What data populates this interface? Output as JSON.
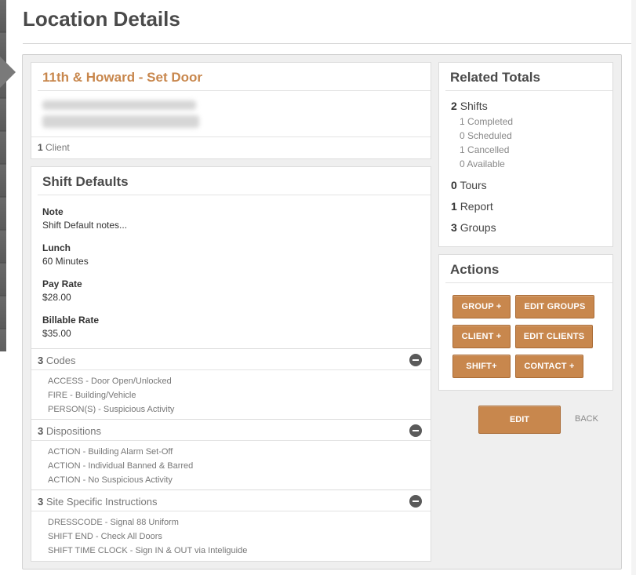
{
  "page": {
    "title": "Location Details"
  },
  "location": {
    "name": "11th & Howard - Set Door",
    "client_count": "1",
    "client_label": "Client"
  },
  "shift_defaults": {
    "heading": "Shift Defaults",
    "fields": [
      {
        "label": "Note",
        "value": "Shift Default notes..."
      },
      {
        "label": "Lunch",
        "value": "60 Minutes"
      },
      {
        "label": "Pay Rate",
        "value": "$28.00"
      },
      {
        "label": "Billable Rate",
        "value": "$35.00"
      }
    ],
    "sections": [
      {
        "count": "3",
        "label": "Codes",
        "items": [
          "ACCESS - Door Open/Unlocked",
          "FIRE - Building/Vehicle",
          "PERSON(S) - Suspicious Activity"
        ]
      },
      {
        "count": "3",
        "label": "Dispositions",
        "items": [
          "ACTION - Building Alarm Set-Off",
          "ACTION - Individual Banned & Barred",
          "ACTION - No Suspicious Activity"
        ]
      },
      {
        "count": "3",
        "label": "Site Specific Instructions",
        "items": [
          "DRESSCODE - Signal 88 Uniform",
          "SHIFT END - Check All Doors",
          "SHIFT TIME CLOCK - Sign IN & OUT via Inteliguide"
        ]
      }
    ]
  },
  "related_totals": {
    "heading": "Related Totals",
    "shifts": {
      "count": "2",
      "label": "Shifts"
    },
    "shift_breakdown": [
      {
        "count": "1",
        "label": "Completed"
      },
      {
        "count": "0",
        "label": "Scheduled"
      },
      {
        "count": "1",
        "label": "Cancelled"
      },
      {
        "count": "0",
        "label": "Available"
      }
    ],
    "tours": {
      "count": "0",
      "label": "Tours"
    },
    "report": {
      "count": "1",
      "label": "Report"
    },
    "groups": {
      "count": "3",
      "label": "Groups"
    }
  },
  "actions": {
    "heading": "Actions",
    "group_add": "GROUP +",
    "edit_groups": "EDIT GROUPS",
    "client_add": "CLIENT +",
    "edit_clients": "EDIT CLIENTS",
    "shift_add": "SHIFT+",
    "contact_add": "CONTACT +"
  },
  "footer": {
    "edit": "EDIT",
    "back": "BACK"
  },
  "colors": {
    "accent": "#c8874d",
    "frame": "#efefef"
  }
}
